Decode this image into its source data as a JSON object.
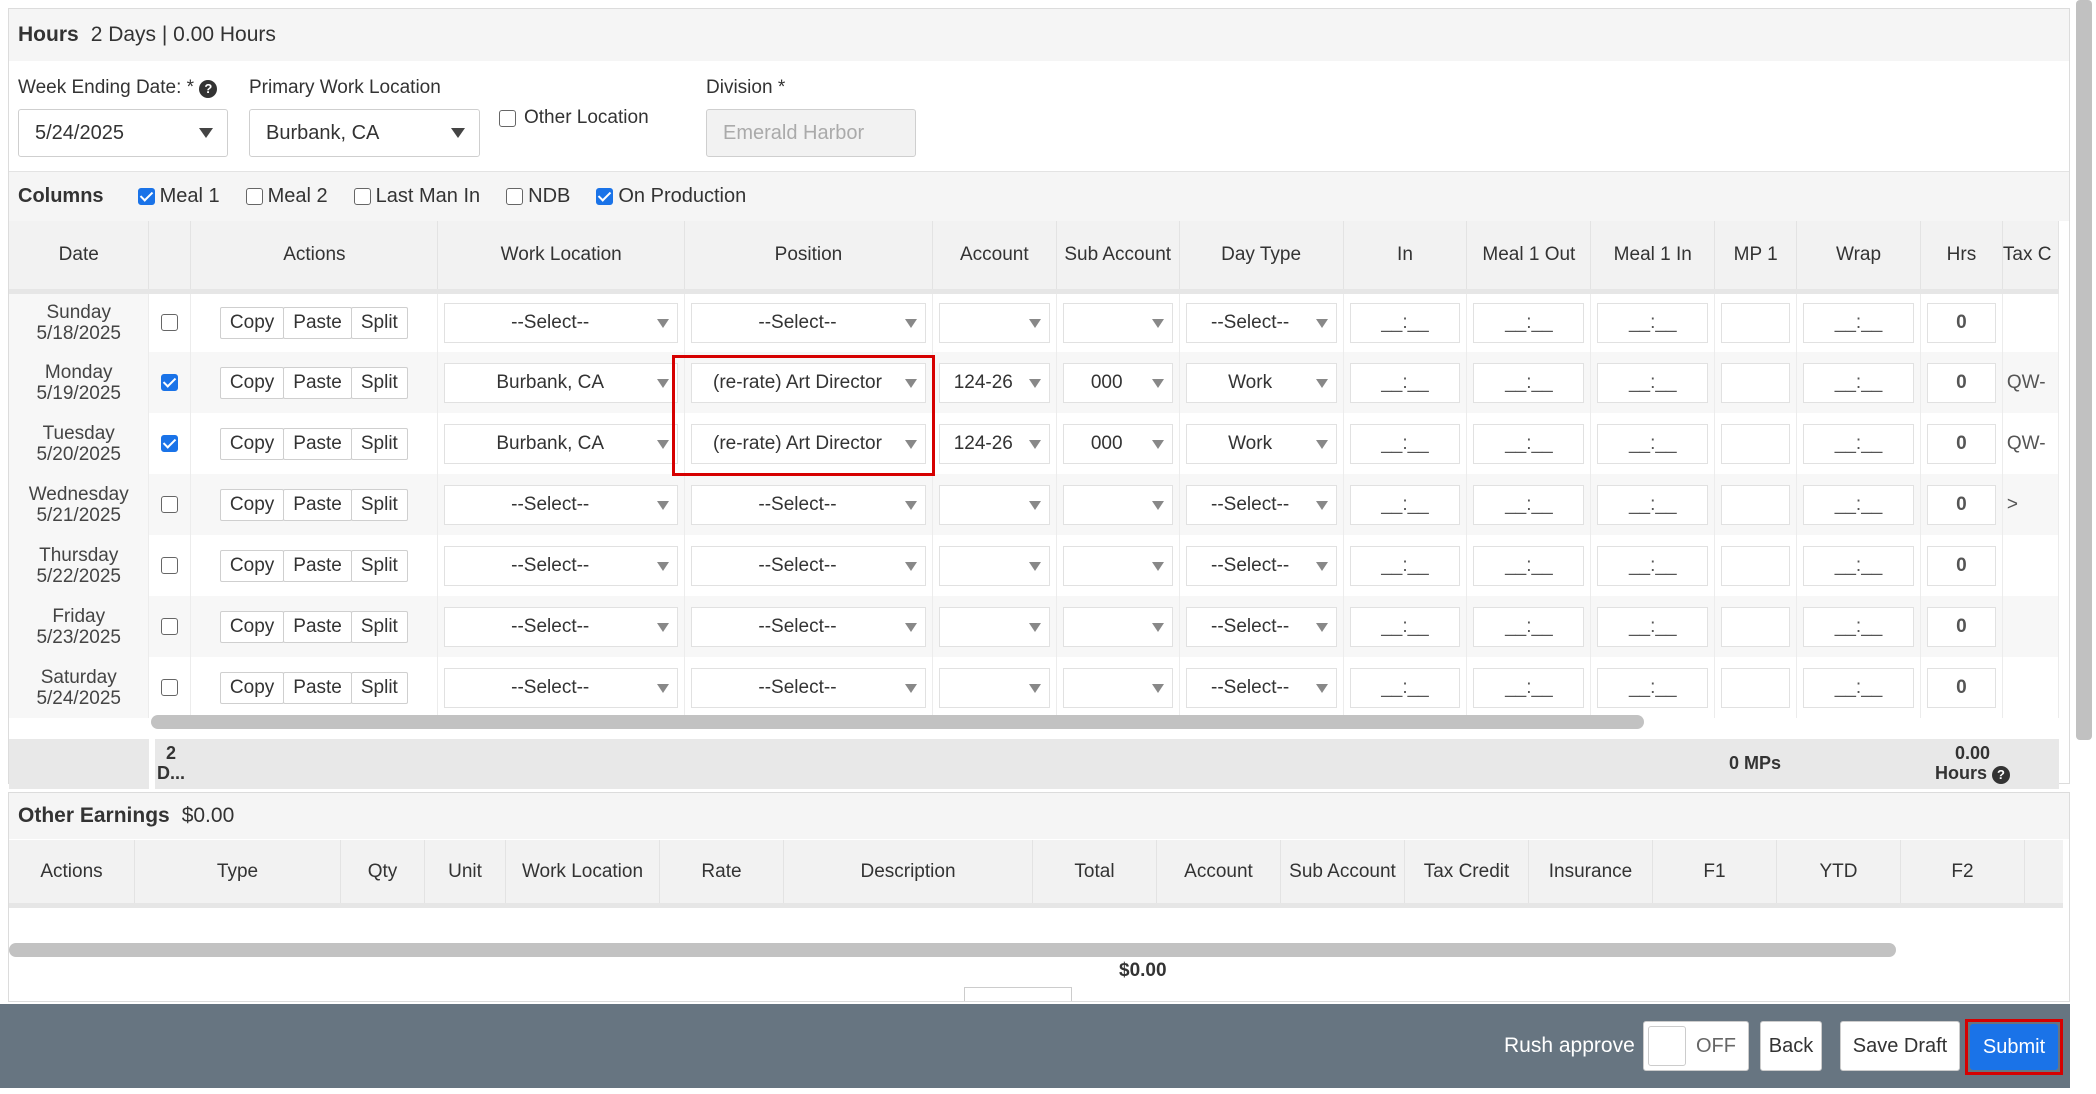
{
  "hours": {
    "title": "Hours",
    "summary": "2 Days | 0.00 Hours",
    "week_ending_label": "Week Ending Date: *",
    "week_ending_value": "5/24/2025",
    "primary_location_label": "Primary Work Location",
    "primary_location_value": "Burbank, CA",
    "other_location_label": "Other Location",
    "division_label": "Division",
    "division_required": "*",
    "division_placeholder": "Emerald Harbor",
    "columns_label": "Columns",
    "column_options": [
      {
        "label": "Meal 1",
        "checked": true
      },
      {
        "label": "Meal 2",
        "checked": false
      },
      {
        "label": "Last Man In",
        "checked": false
      },
      {
        "label": "NDB",
        "checked": false
      },
      {
        "label": "On Production",
        "checked": true
      }
    ],
    "headers": [
      "Date",
      "",
      "Actions",
      "Work Location",
      "Position",
      "Account",
      "Sub Account",
      "Day Type",
      "In",
      "Meal 1 Out",
      "Meal 1 In",
      "MP 1",
      "Wrap",
      "Hrs",
      "Tax C"
    ],
    "action_buttons": [
      "Copy",
      "Paste",
      "Split"
    ],
    "rows": [
      {
        "day": "Sunday",
        "date": "5/18/2025",
        "checked": false,
        "location": "--Select--",
        "position": "--Select--",
        "account": "",
        "sub": "",
        "daytype": "--Select--",
        "hrs": "0",
        "tax": ""
      },
      {
        "day": "Monday",
        "date": "5/19/2025",
        "checked": true,
        "location": "Burbank, CA",
        "position": "(re-rate) Art Director",
        "account": "124-26",
        "sub": "000",
        "daytype": "Work",
        "hrs": "0",
        "tax": "QW-"
      },
      {
        "day": "Tuesday",
        "date": "5/20/2025",
        "checked": true,
        "location": "Burbank, CA",
        "position": "(re-rate) Art Director",
        "account": "124-26",
        "sub": "000",
        "daytype": "Work",
        "hrs": "0",
        "tax": "QW-"
      },
      {
        "day": "Wednesday",
        "date": "5/21/2025",
        "checked": false,
        "location": "--Select--",
        "position": "--Select--",
        "account": "",
        "sub": "",
        "daytype": "--Select--",
        "hrs": "0",
        "tax": ">"
      },
      {
        "day": "Thursday",
        "date": "5/22/2025",
        "checked": false,
        "location": "--Select--",
        "position": "--Select--",
        "account": "",
        "sub": "",
        "daytype": "--Select--",
        "hrs": "0",
        "tax": ""
      },
      {
        "day": "Friday",
        "date": "5/23/2025",
        "checked": false,
        "location": "--Select--",
        "position": "--Select--",
        "account": "",
        "sub": "",
        "daytype": "--Select--",
        "hrs": "0",
        "tax": ""
      },
      {
        "day": "Saturday",
        "date": "5/24/2025",
        "checked": false,
        "location": "--Select--",
        "position": "--Select--",
        "account": "",
        "sub": "",
        "daytype": "--Select--",
        "hrs": "0",
        "tax": ""
      }
    ],
    "time_placeholder": "__:__",
    "totals_days": "2 D...",
    "totals_mps": "0 MPs",
    "totals_hours": "0.00 Hours"
  },
  "other_earnings": {
    "title": "Other Earnings",
    "amount": "$0.00",
    "headers": [
      "Actions",
      "Type",
      "Qty",
      "Unit",
      "Work Location",
      "Rate",
      "Description",
      "Total",
      "Account",
      "Sub Account",
      "Tax Credit",
      "Insurance",
      "F1",
      "YTD",
      "F2"
    ],
    "total": "$0.00"
  },
  "footer": {
    "rush_label": "Rush approve",
    "toggle_state": "OFF",
    "back": "Back",
    "save_draft": "Save Draft",
    "submit": "Submit"
  },
  "colors": {
    "accent": "#1a73e8",
    "footer": "#677581",
    "highlight": "#d60000"
  }
}
